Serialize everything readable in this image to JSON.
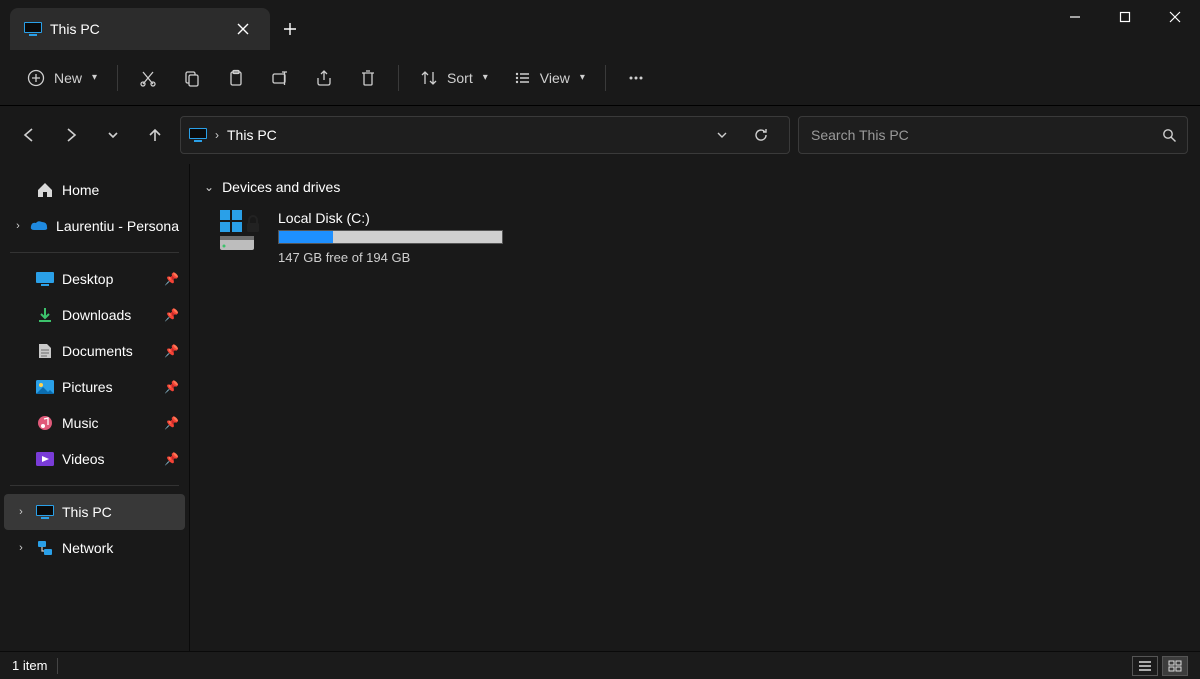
{
  "tab": {
    "title": "This PC"
  },
  "toolbar": {
    "new_label": "New",
    "sort_label": "Sort",
    "view_label": "View"
  },
  "address": {
    "location": "This PC"
  },
  "search": {
    "placeholder": "Search This PC"
  },
  "sidebar": {
    "home": "Home",
    "onedrive": "Laurentiu - Persona",
    "quick": [
      {
        "label": "Desktop"
      },
      {
        "label": "Downloads"
      },
      {
        "label": "Documents"
      },
      {
        "label": "Pictures"
      },
      {
        "label": "Music"
      },
      {
        "label": "Videos"
      }
    ],
    "this_pc": "This PC",
    "network": "Network"
  },
  "content": {
    "group_header": "Devices and drives",
    "drive": {
      "name": "Local Disk (C:)",
      "free_text": "147 GB free of 194 GB",
      "used_pct": 24
    }
  },
  "status": {
    "count_text": "1 item"
  }
}
